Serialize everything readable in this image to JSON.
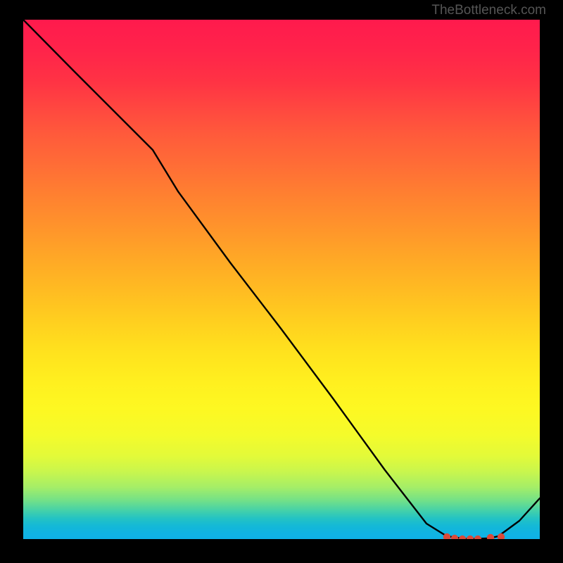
{
  "attribution": "TheBottleneck.com",
  "chart_data": {
    "type": "line",
    "title": "",
    "xlabel": "",
    "ylabel": "",
    "x": [
      0.0,
      0.1,
      0.2,
      0.25,
      0.3,
      0.4,
      0.5,
      0.6,
      0.7,
      0.78,
      0.82,
      0.86,
      0.9,
      0.92,
      0.96,
      1.0
    ],
    "values": [
      1.0,
      0.9,
      0.8,
      0.75,
      0.67,
      0.53,
      0.4,
      0.27,
      0.13,
      0.03,
      0.005,
      0.0,
      0.0,
      0.005,
      0.035,
      0.08
    ],
    "xlim": [
      0,
      1
    ],
    "ylim": [
      0,
      1
    ],
    "annotations": [
      {
        "x": 0.82,
        "y": 0.003,
        "marker": "dot",
        "color": "#d94a3a"
      },
      {
        "x": 0.835,
        "y": 0.001,
        "marker": "dot",
        "color": "#d94a3a"
      },
      {
        "x": 0.85,
        "y": 0.0,
        "marker": "dot",
        "color": "#d94a3a"
      },
      {
        "x": 0.865,
        "y": 0.0,
        "marker": "dot",
        "color": "#d94a3a"
      },
      {
        "x": 0.88,
        "y": 0.0,
        "marker": "dot",
        "color": "#d94a3a"
      },
      {
        "x": 0.905,
        "y": 0.002,
        "marker": "dot",
        "color": "#d94a3a"
      },
      {
        "x": 0.925,
        "y": 0.004,
        "marker": "dot",
        "color": "#d94a3a"
      }
    ],
    "line_color": "#000000",
    "background_gradient": [
      "#ff1a4d",
      "#ffe21e",
      "#0fb2e7"
    ]
  }
}
